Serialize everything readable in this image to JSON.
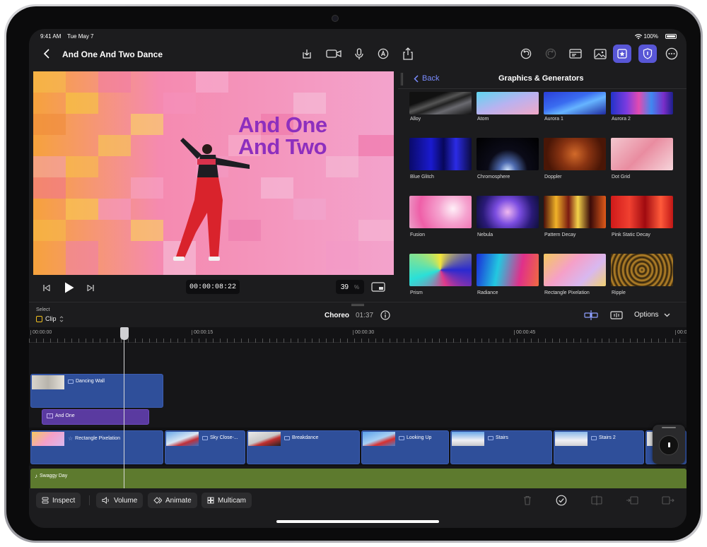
{
  "status": {
    "time": "9:41 AM",
    "date": "Tue May 7",
    "battery": "100%"
  },
  "header": {
    "title": "And One And Two Dance"
  },
  "viewer": {
    "title_line1": "And One",
    "title_line2": "And Two"
  },
  "player": {
    "timecode": "00:00:08:22",
    "zoom": "39",
    "zoom_unit": "%"
  },
  "browser": {
    "back_label": "Back",
    "title": "Graphics & Generators",
    "items": [
      {
        "label": "Alloy"
      },
      {
        "label": "Atom"
      },
      {
        "label": "Aurora 1"
      },
      {
        "label": "Aurora 2"
      },
      {
        "label": "Blue Glitch"
      },
      {
        "label": "Chromosphere"
      },
      {
        "label": "Doppler"
      },
      {
        "label": "Dot Grid"
      },
      {
        "label": "Fusion"
      },
      {
        "label": "Nebula"
      },
      {
        "label": "Pattern Decay"
      },
      {
        "label": "Pink Static Decay"
      },
      {
        "label": "Prism"
      },
      {
        "label": "Radiance"
      },
      {
        "label": "Rectangle Pixelation"
      },
      {
        "label": "Ripple"
      }
    ]
  },
  "timeline_header": {
    "select_label": "Select",
    "mode": "Clip",
    "project": "Choreo",
    "duration": "01:37",
    "options_label": "Options"
  },
  "ruler": [
    "00:00:00",
    "00:00:15",
    "00:00:30",
    "00:00:45"
  ],
  "clips": {
    "dancing_wall": "Dancing Wall",
    "title_clip": "And One",
    "primary": [
      "Rectangle Pixelation",
      "Sky Close-...",
      "Breakdance",
      "Looking Up",
      "Stairs",
      "Stairs 2"
    ],
    "audio": "Swaggy Day"
  },
  "bottombar": {
    "inspect": "Inspect",
    "volume": "Volume",
    "animate": "Animate",
    "multicam": "Multicam"
  },
  "colors": {
    "accent": "#5856d6",
    "clip_blue": "#2f4f9a",
    "title_purple": "#5a3aa0",
    "audio_green": "#5d7a2e",
    "link_blue": "#7a8cff"
  }
}
